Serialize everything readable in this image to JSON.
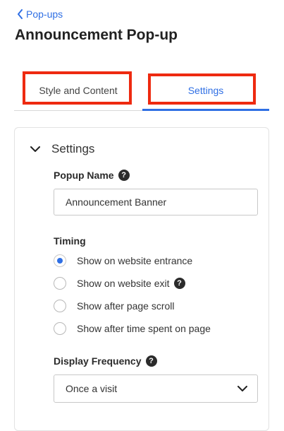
{
  "back_link": {
    "label": "Pop-ups",
    "icon": "chevron-left-icon"
  },
  "page_title": "Announcement Pop-up",
  "tabs": [
    {
      "label": "Style and Content",
      "active": false
    },
    {
      "label": "Settings",
      "active": true
    }
  ],
  "panel": {
    "title": "Settings",
    "popup_name": {
      "label": "Popup Name",
      "value": "Announcement Banner"
    },
    "timing": {
      "label": "Timing",
      "options": [
        {
          "label": "Show on website entrance",
          "checked": true,
          "help": false
        },
        {
          "label": "Show on website exit",
          "checked": false,
          "help": true
        },
        {
          "label": "Show after page scroll",
          "checked": false,
          "help": false
        },
        {
          "label": "Show after time spent on page",
          "checked": false,
          "help": false
        }
      ]
    },
    "display_frequency": {
      "label": "Display Frequency",
      "value": "Once a visit"
    }
  },
  "help_glyph": "?",
  "colors": {
    "accent": "#2f6fe4",
    "highlight": "#ee2a10",
    "text": "#2b2b2b",
    "border": "#c8c8c8"
  }
}
